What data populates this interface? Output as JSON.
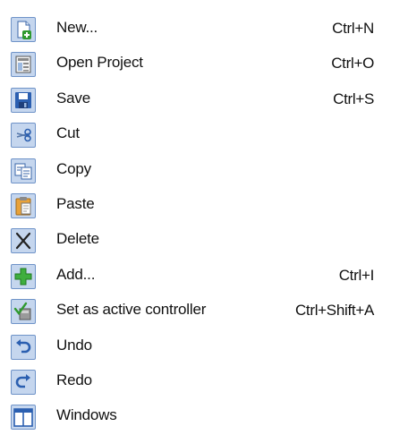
{
  "menu": {
    "items": [
      {
        "label": "New...",
        "shortcut": "Ctrl+N",
        "icon": "new-file-icon"
      },
      {
        "label": "Open Project",
        "shortcut": "Ctrl+O",
        "icon": "open-project-icon"
      },
      {
        "label": "Save",
        "shortcut": "Ctrl+S",
        "icon": "save-icon"
      },
      {
        "label": "Cut",
        "shortcut": "",
        "icon": "cut-icon"
      },
      {
        "label": "Copy",
        "shortcut": "",
        "icon": "copy-icon"
      },
      {
        "label": "Paste",
        "shortcut": "",
        "icon": "paste-icon"
      },
      {
        "label": "Delete",
        "shortcut": "",
        "icon": "delete-icon"
      },
      {
        "label": "Add...",
        "shortcut": "Ctrl+I",
        "icon": "add-icon"
      },
      {
        "label": "Set as active controller",
        "shortcut": "Ctrl+Shift+A",
        "icon": "active-controller-icon"
      },
      {
        "label": "Undo",
        "shortcut": "",
        "icon": "undo-icon"
      },
      {
        "label": "Redo",
        "shortcut": "",
        "icon": "redo-icon"
      },
      {
        "label": "Windows",
        "shortcut": "",
        "icon": "windows-icon"
      }
    ]
  },
  "colors": {
    "icon_background": "#c5d6ee",
    "icon_border": "#6f93c8",
    "text": "#111111"
  }
}
